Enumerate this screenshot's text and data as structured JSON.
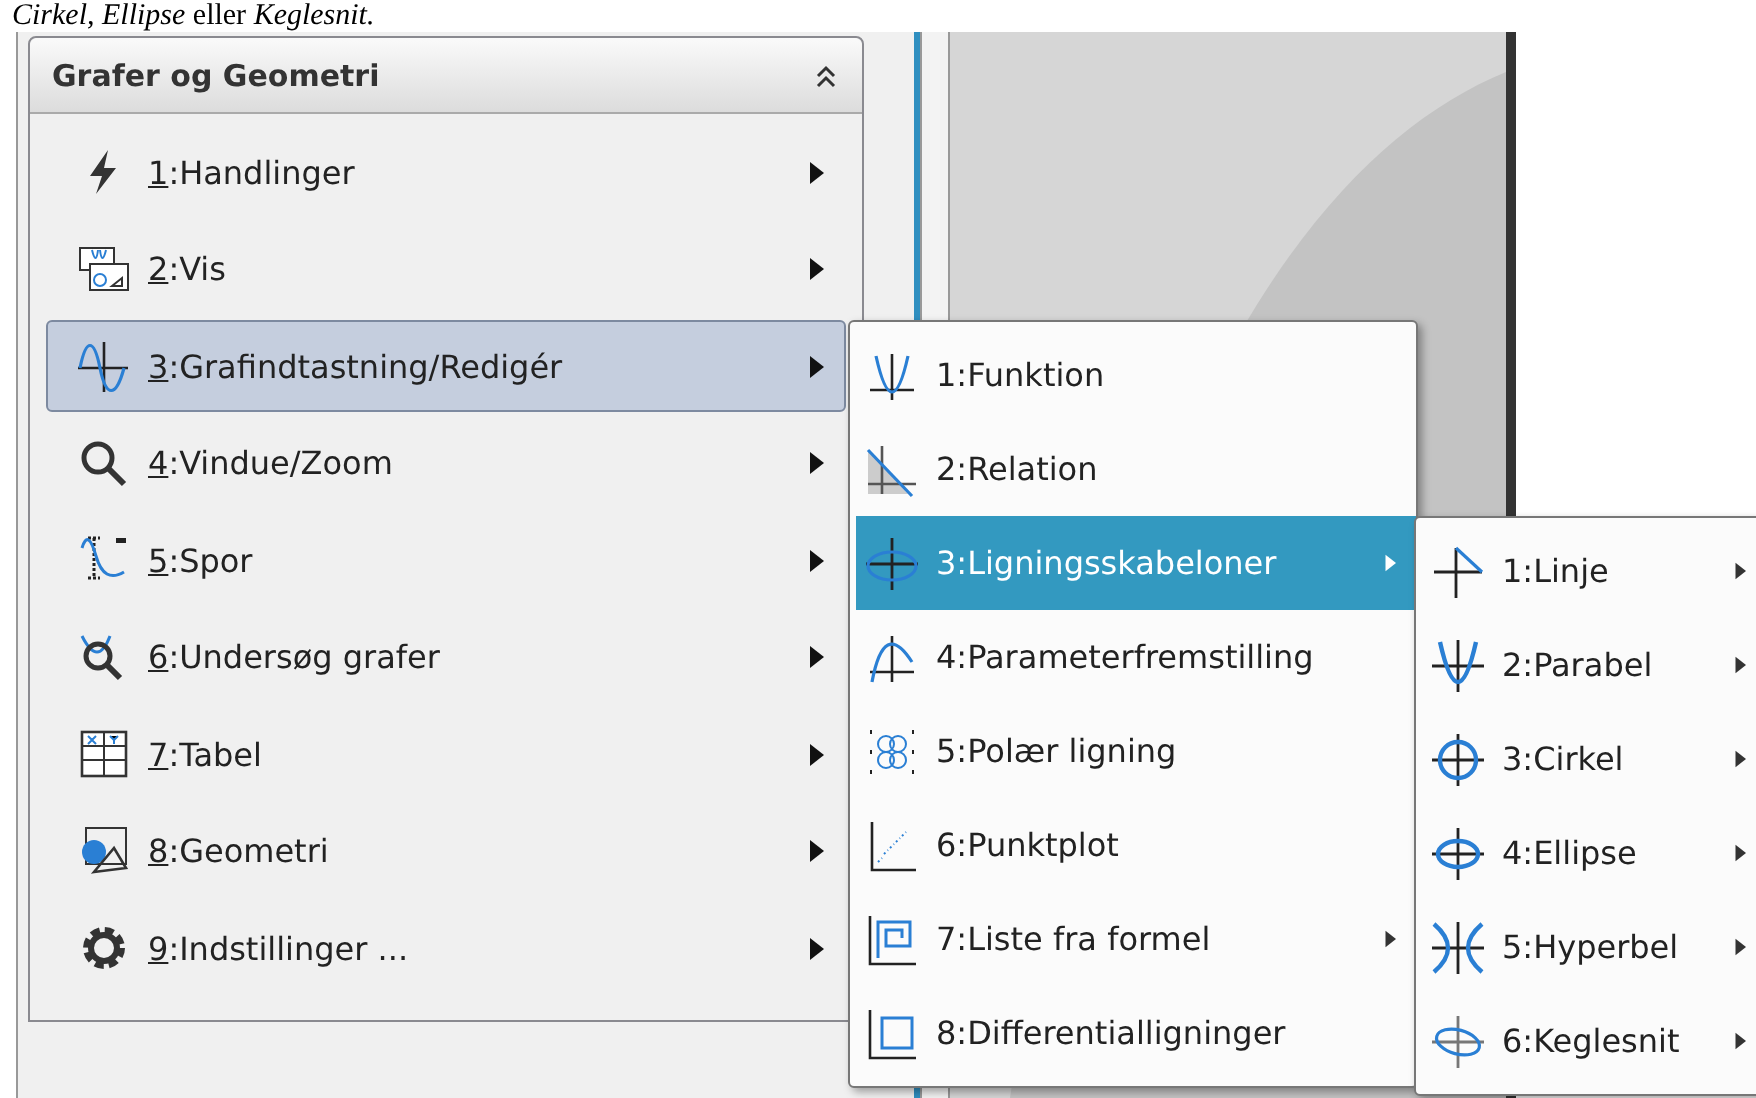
{
  "caption": "*Cirkel, Ellipse* eller *Keglesnit.*",
  "panel": {
    "title": "Grafer og Geometri"
  },
  "menu": {
    "items": [
      {
        "label": "1:Handlinger",
        "selected": false,
        "has_submenu": true
      },
      {
        "label": "2:Vis",
        "selected": false,
        "has_submenu": true
      },
      {
        "label": "3:Grafindtastning/Redigér",
        "selected": true,
        "has_submenu": true
      },
      {
        "label": "4:Vindue/Zoom",
        "selected": false,
        "has_submenu": true
      },
      {
        "label": "5:Spor",
        "selected": false,
        "has_submenu": true
      },
      {
        "label": "6:Undersøg grafer",
        "selected": false,
        "has_submenu": true
      },
      {
        "label": "7:Tabel",
        "selected": false,
        "has_submenu": true
      },
      {
        "label": "8:Geometri",
        "selected": false,
        "has_submenu": true
      },
      {
        "label": "9:Indstillinger ...",
        "selected": false,
        "has_submenu": true
      }
    ]
  },
  "submenu": {
    "items": [
      {
        "label": "1:Funktion",
        "selected": false,
        "has_submenu": false
      },
      {
        "label": "2:Relation",
        "selected": false,
        "has_submenu": false
      },
      {
        "label": "3:Ligningsskabeloner",
        "selected": true,
        "has_submenu": true
      },
      {
        "label": "4:Parameterfremstilling",
        "selected": false,
        "has_submenu": false
      },
      {
        "label": "5:Polær ligning",
        "selected": false,
        "has_submenu": false
      },
      {
        "label": "6:Punktplot",
        "selected": false,
        "has_submenu": false
      },
      {
        "label": "7:Liste fra formel",
        "selected": false,
        "has_submenu": true
      },
      {
        "label": "8:Differentialligninger",
        "selected": false,
        "has_submenu": false
      }
    ]
  },
  "templates_menu": {
    "items": [
      {
        "label": "1:Linje",
        "selected": false,
        "has_submenu": true
      },
      {
        "label": "2:Parabel",
        "selected": false,
        "has_submenu": true
      },
      {
        "label": "3:Cirkel",
        "selected": false,
        "has_submenu": true
      },
      {
        "label": "4:Ellipse",
        "selected": false,
        "has_submenu": true
      },
      {
        "label": "5:Hyperbel",
        "selected": false,
        "has_submenu": true
      },
      {
        "label": "6:Keglesnit",
        "selected": false,
        "has_submenu": true
      }
    ]
  }
}
